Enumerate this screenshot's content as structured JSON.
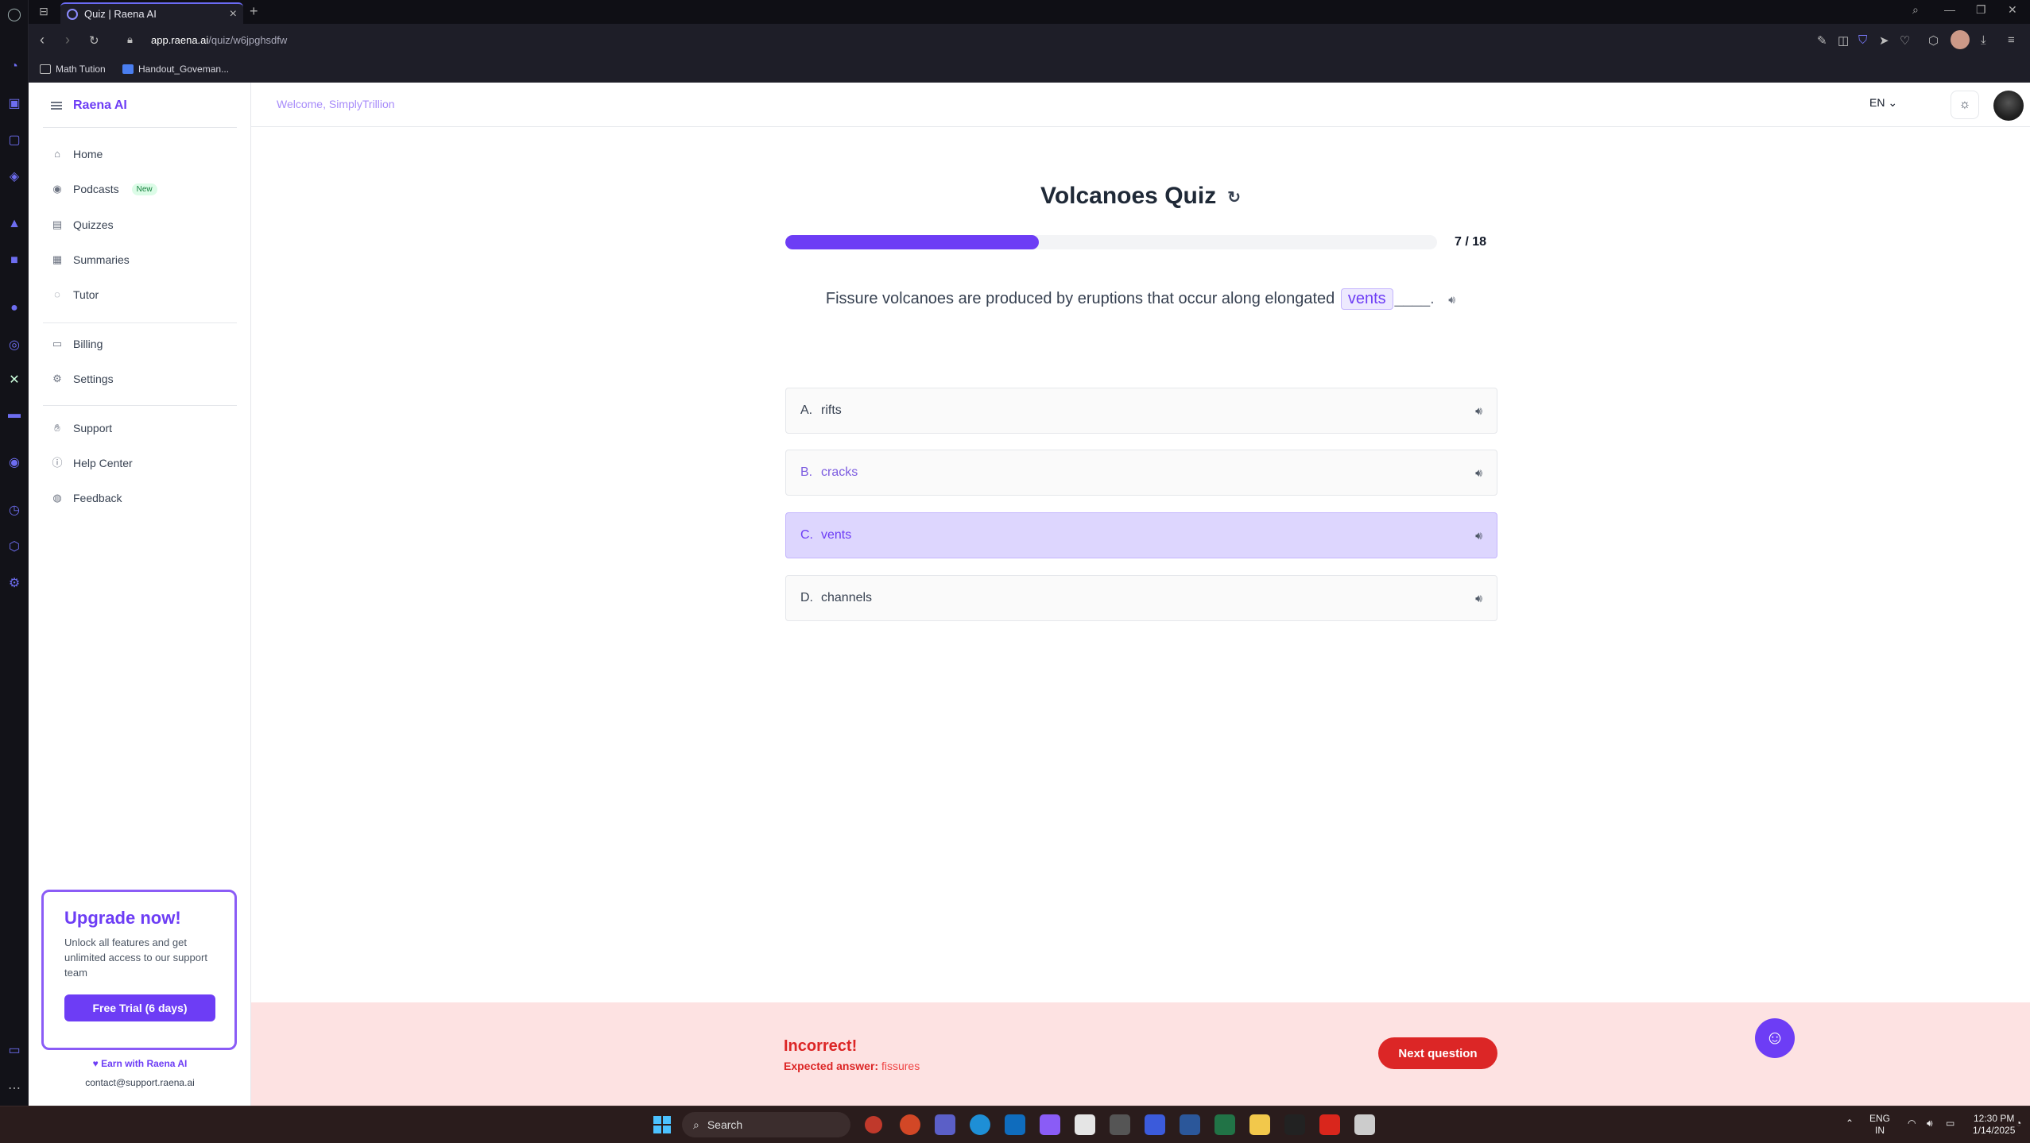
{
  "browser": {
    "tab_title": "Quiz | Raena AI",
    "url_domain": "app.raena.ai",
    "url_path": "/quiz/w6jpghsdfw",
    "bookmarks": [
      "Math Tution",
      "Handout_Goveman..."
    ]
  },
  "sidebar": {
    "brand": "Raena AI",
    "nav": [
      {
        "label": "Home",
        "icon": "home-icon"
      },
      {
        "label": "Podcasts",
        "icon": "podcast-icon",
        "badge": "New"
      },
      {
        "label": "Quizzes",
        "icon": "quiz-icon"
      },
      {
        "label": "Summaries",
        "icon": "summary-icon"
      },
      {
        "label": "Tutor",
        "icon": "chat-icon"
      },
      {
        "label": "Billing",
        "icon": "card-icon"
      },
      {
        "label": "Settings",
        "icon": "gear-icon"
      },
      {
        "label": "Support",
        "icon": "handshake-icon"
      },
      {
        "label": "Help Center",
        "icon": "help-icon"
      },
      {
        "label": "Feedback",
        "icon": "feedback-icon"
      }
    ],
    "upgrade": {
      "title": "Upgrade now!",
      "text": "Unlock all features and get unlimited access to our support team",
      "button": "Free Trial (6 days)"
    },
    "earn": "Earn with Raena AI",
    "contact": "contact@support.raena.ai"
  },
  "topbar": {
    "welcome": "Welcome, SimplyTrillion",
    "language": "EN"
  },
  "quiz": {
    "title": "Volcanoes Quiz",
    "progress_current": 7,
    "progress_total": 18,
    "progress_label": "7 / 18",
    "progress_fraction": 0.389,
    "question_before": "Fissure volcanoes are produced by eruptions that occur along elongated",
    "question_chip": "vents",
    "question_blank": "____.",
    "options": [
      {
        "letter": "A.",
        "text": "rifts",
        "state": "default"
      },
      {
        "letter": "B.",
        "text": "cracks",
        "state": "muted"
      },
      {
        "letter": "C.",
        "text": "vents",
        "state": "selected"
      },
      {
        "letter": "D.",
        "text": "channels",
        "state": "default"
      }
    ]
  },
  "feedback": {
    "status": "Incorrect!",
    "expected_label": "Expected answer:",
    "expected_value": "fissures",
    "next_button": "Next question"
  },
  "taskbar": {
    "search_placeholder": "Search",
    "lang_line1": "ENG",
    "lang_line2": "IN",
    "time": "12:30 PM",
    "date": "1/14/2025"
  },
  "colors": {
    "accent": "#6d3df5",
    "error": "#dc2626",
    "error_bg": "#fde2e2"
  }
}
